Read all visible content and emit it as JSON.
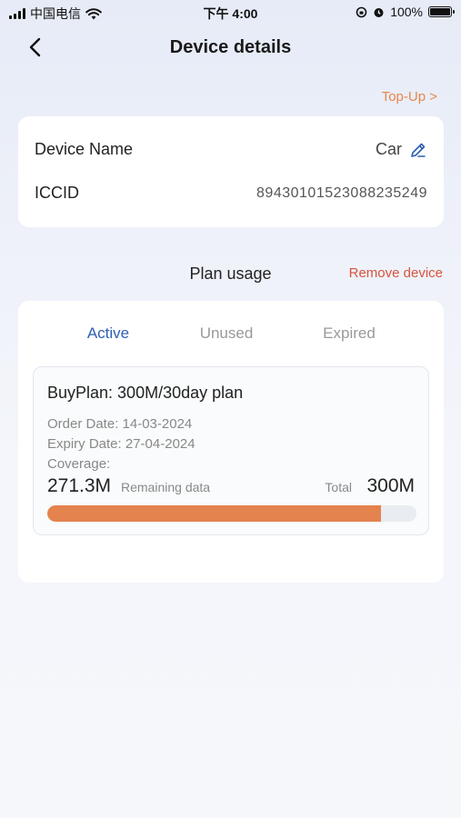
{
  "status_bar": {
    "carrier": "中国电信",
    "time": "下午 4:00",
    "battery": "100%"
  },
  "header": {
    "title": "Device details",
    "back_icon": "chevron-left-icon",
    "top_up_label": "Top-Up >"
  },
  "device": {
    "name_label": "Device Name",
    "name_value": "Car",
    "edit_icon": "pencil-icon",
    "iccid_label": "ICCID",
    "iccid_value": "89430101523088235249"
  },
  "usage": {
    "section_title": "Plan usage",
    "remove_label": "Remove device",
    "tabs": [
      {
        "label": "Active",
        "selected": true
      },
      {
        "label": "Unused",
        "selected": false
      },
      {
        "label": "Expired",
        "selected": false
      }
    ],
    "plan": {
      "title": "BuyPlan: 300M/30day plan",
      "order_date": "Order Date: 14-03-2024",
      "expiry_date": "Expiry  Date: 27-04-2024",
      "coverage": "Coverage:",
      "remaining_value": "271.3M",
      "remaining_label": "Remaining data",
      "total_label": "Total",
      "total_value": "300M",
      "remaining_fraction": 0.904
    }
  },
  "colors": {
    "accent_blue": "#2d5fb4",
    "accent_orange": "#e8874a",
    "danger_red": "#d9533f",
    "progress_fill": "#e4834e"
  }
}
